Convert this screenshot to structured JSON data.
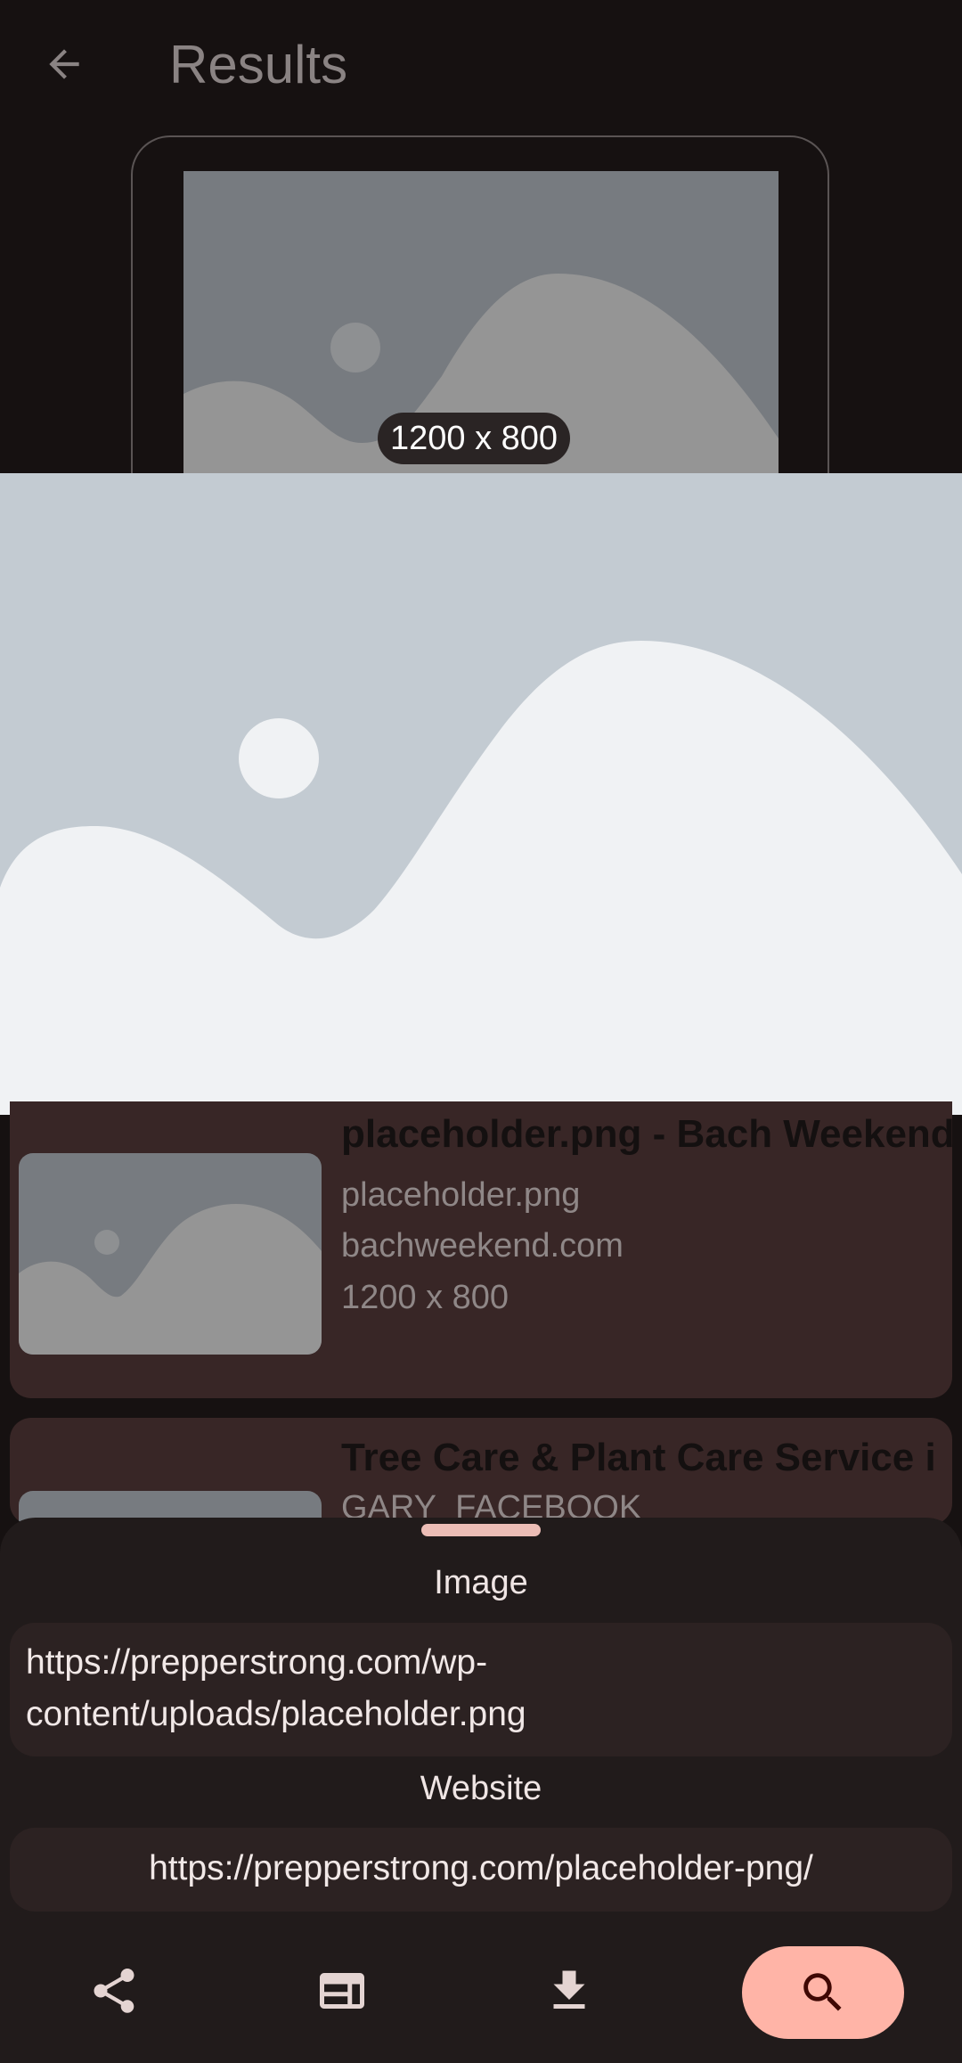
{
  "appbar": {
    "title": "Results",
    "back_icon": "arrow-back-icon"
  },
  "preview": {
    "dimensions": "1200 x 800"
  },
  "results": [
    {
      "title": "placeholder.png - Bach Weekend",
      "filename": "placeholder.png",
      "site": "bachweekend.com",
      "dimensions": "1200 x 800"
    },
    {
      "title": "Tree Care & Plant Care Service i",
      "site": "GARY_FACEBOOK"
    }
  ],
  "sheet": {
    "image_label": "Image",
    "image_url": "https://prepperstrong.com/wp-content/uploads/placeholder.png",
    "website_label": "Website",
    "website_url": "https://prepperstrong.com/placeholder-png/"
  },
  "actions": {
    "share_icon": "share-icon",
    "open_browser_icon": "web-icon",
    "download_icon": "download-icon",
    "search_icon": "search-icon"
  },
  "colors": {
    "accent": "#ffb4a7",
    "card_bg": "#382626",
    "sheet_bg": "#211b1b"
  }
}
